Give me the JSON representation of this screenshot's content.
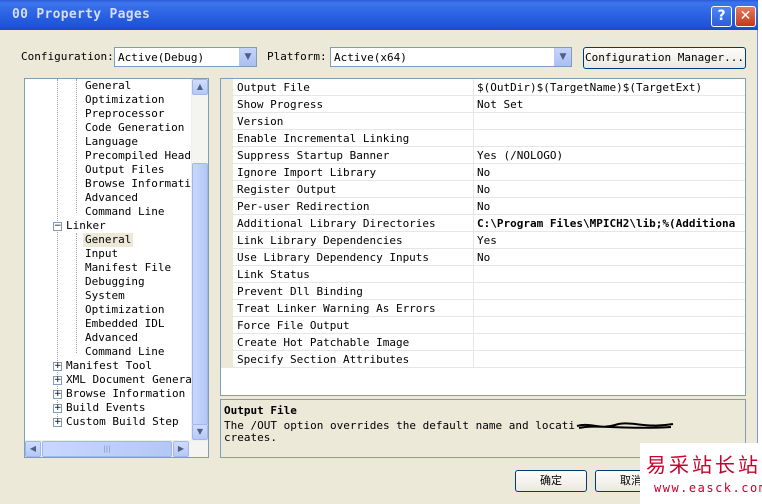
{
  "window": {
    "title": "00 Property Pages",
    "help_label": "?",
    "close_label": "✕"
  },
  "toolbar": {
    "configuration_label": "Configuration:",
    "configuration_value": "Active(Debug)",
    "platform_label": "Platform:",
    "platform_value": "Active(x64)",
    "config_manager_label": "Configuration Manager..."
  },
  "tree": {
    "items": [
      {
        "label": "General"
      },
      {
        "label": "Optimization"
      },
      {
        "label": "Preprocessor"
      },
      {
        "label": "Code Generation"
      },
      {
        "label": "Language"
      },
      {
        "label": "Precompiled Heade"
      },
      {
        "label": "Output Files"
      },
      {
        "label": "Browse Informatio"
      },
      {
        "label": "Advanced"
      },
      {
        "label": "Command Line"
      },
      {
        "label": "Linker"
      },
      {
        "label": "General"
      },
      {
        "label": "Input"
      },
      {
        "label": "Manifest File"
      },
      {
        "label": "Debugging"
      },
      {
        "label": "System"
      },
      {
        "label": "Optimization"
      },
      {
        "label": "Embedded IDL"
      },
      {
        "label": "Advanced"
      },
      {
        "label": "Command Line"
      },
      {
        "label": "Manifest Tool"
      },
      {
        "label": "XML Document Generato"
      },
      {
        "label": "Browse Information"
      },
      {
        "label": "Build Events"
      },
      {
        "label": "Custom Build Step"
      }
    ],
    "scroll_grip": "|||"
  },
  "properties": [
    {
      "name": "Output File",
      "value": "$(OutDir)$(TargetName)$(TargetExt)",
      "bold": false
    },
    {
      "name": "Show Progress",
      "value": "Not Set",
      "bold": false
    },
    {
      "name": "Version",
      "value": "",
      "bold": false
    },
    {
      "name": "Enable Incremental Linking",
      "value": "",
      "bold": false
    },
    {
      "name": "Suppress Startup Banner",
      "value": "Yes (/NOLOGO)",
      "bold": false
    },
    {
      "name": "Ignore Import Library",
      "value": "No",
      "bold": false
    },
    {
      "name": "Register Output",
      "value": "No",
      "bold": false
    },
    {
      "name": "Per-user Redirection",
      "value": "No",
      "bold": false
    },
    {
      "name": "Additional Library Directories",
      "value": "C:\\Program Files\\MPICH2\\lib;%(Additiona",
      "bold": true
    },
    {
      "name": "Link Library Dependencies",
      "value": "Yes",
      "bold": false
    },
    {
      "name": "Use Library Dependency Inputs",
      "value": "No",
      "bold": false
    },
    {
      "name": "Link Status",
      "value": "",
      "bold": false
    },
    {
      "name": "Prevent Dll Binding",
      "value": "",
      "bold": false
    },
    {
      "name": "Treat Linker Warning As Errors",
      "value": "",
      "bold": false
    },
    {
      "name": "Force File Output",
      "value": "",
      "bold": false
    },
    {
      "name": "Create Hot Patchable Image",
      "value": "",
      "bold": false
    },
    {
      "name": "Specify Section Attributes",
      "value": "",
      "bold": false
    }
  ],
  "description": {
    "title": "Output File",
    "text_line1": "The /OUT option overrides the default name and locati",
    "text_line2": "creates."
  },
  "buttons": {
    "ok_label": "确定",
    "cancel_label": "取消"
  },
  "watermark": {
    "text": "易采站长站",
    "url": "www.easck.com"
  },
  "colors": {
    "titlebar": "#2a62e4",
    "dialog_bg": "#ece9d8",
    "watermark": "#c8002c"
  }
}
